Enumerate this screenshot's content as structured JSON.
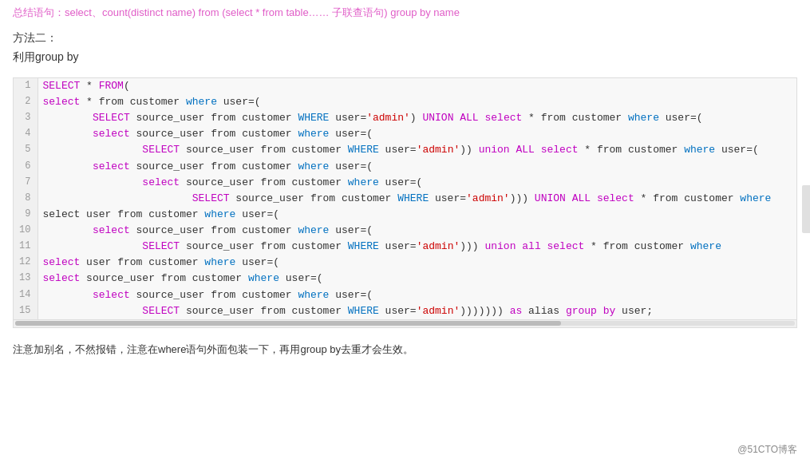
{
  "top": {
    "intro_text": "总结语句：select、count(distinct name) from (select * from table…… 子联查语句) group by name"
  },
  "method2": {
    "label": "方法二：",
    "sublabel": "利用group by"
  },
  "code": {
    "lines": [
      {
        "num": 1,
        "content": "SELECT * FROM("
      },
      {
        "num": 2,
        "content": "select * from customer where user=("
      },
      {
        "num": 3,
        "content": "        SELECT source_user from customer WHERE user='admin') UNION ALL select * from customer where user=("
      },
      {
        "num": 4,
        "content": "        select source_user from customer where user=("
      },
      {
        "num": 5,
        "content": "                SELECT source_user from customer WHERE user='admin')) union ALL select * from customer where user=("
      },
      {
        "num": 6,
        "content": "        select source_user from customer where user=("
      },
      {
        "num": 7,
        "content": "                select source_user from customer where user=("
      },
      {
        "num": 8,
        "content": "                        SELECT source_user from customer WHERE user='admin'))) UNION ALL select * from customer where"
      },
      {
        "num": 9,
        "content": "select user from customer where user=("
      },
      {
        "num": 10,
        "content": "        select source_user from customer where user=("
      },
      {
        "num": 11,
        "content": "                SELECT source_user from customer WHERE user='admin'))) union all select * from customer where"
      },
      {
        "num": 12,
        "content": "select user from customer where user=("
      },
      {
        "num": 13,
        "content": "select source_user from customer where user=("
      },
      {
        "num": 14,
        "content": "        select source_user from customer where user=("
      },
      {
        "num": 15,
        "content": "                SELECT source_user from customer WHERE user='admin'))))))) as alias group by user;"
      }
    ]
  },
  "footer": {
    "note": "注意加别名，不然报错，注意在where语句外面包装一下，再用group by去重才会生效。"
  },
  "brand": {
    "text": "@51CTO博客"
  }
}
